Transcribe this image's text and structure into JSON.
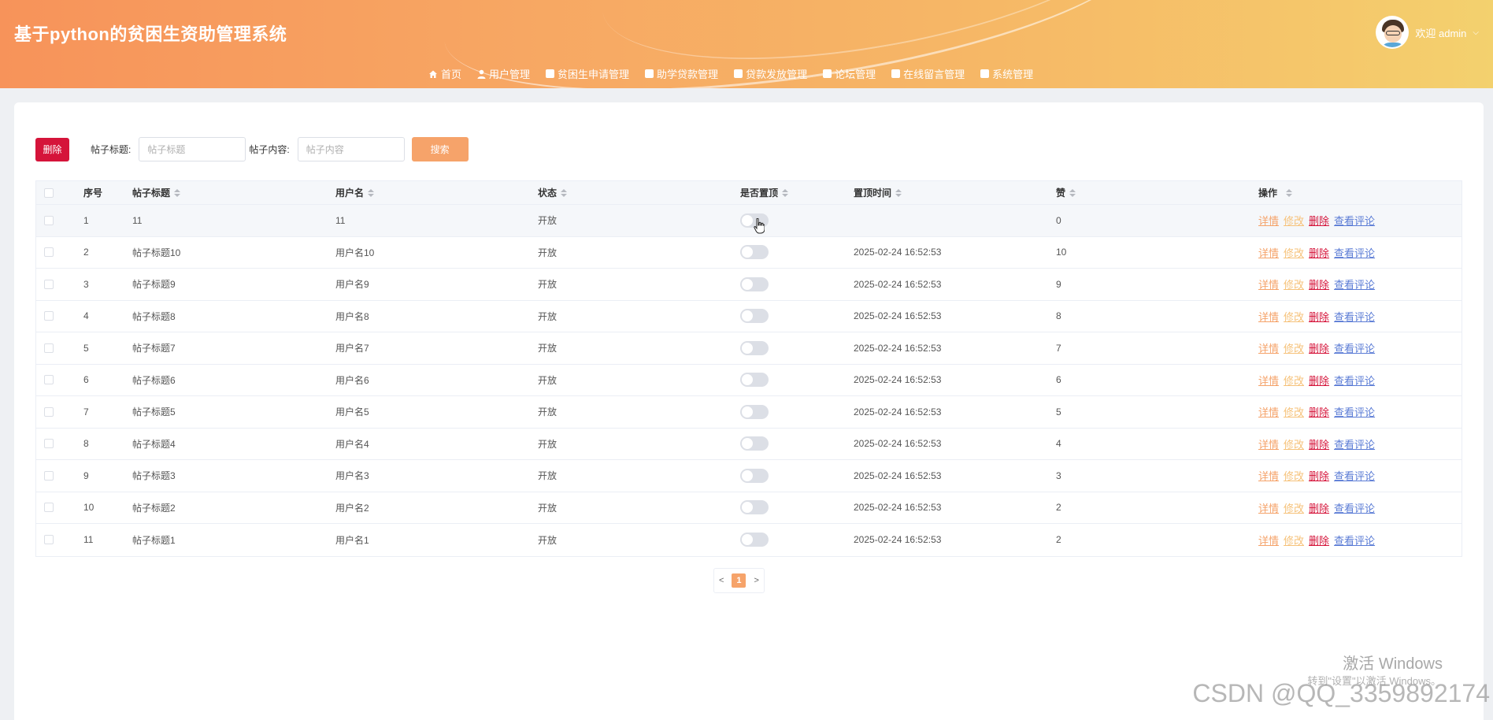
{
  "header": {
    "title": "基于python的贫困生资助管理系统",
    "welcome": "欢迎 admin",
    "nav": [
      {
        "label": "首页",
        "icon": "home-icon"
      },
      {
        "label": "用户管理",
        "icon": "user-icon"
      },
      {
        "label": "贫困生申请管理",
        "icon": "folder-icon"
      },
      {
        "label": "助学贷款管理",
        "icon": "document-icon"
      },
      {
        "label": "贷款发放管理",
        "icon": "document-icon"
      },
      {
        "label": "论坛管理",
        "icon": "document-icon"
      },
      {
        "label": "在线留言管理",
        "icon": "document-icon"
      },
      {
        "label": "系统管理",
        "icon": "settings-icon"
      }
    ]
  },
  "toolbar": {
    "delete_label": "删除",
    "title_label": "帖子标题:",
    "title_placeholder": "帖子标题",
    "content_label": "帖子内容:",
    "content_placeholder": "帖子内容",
    "search_label": "搜索"
  },
  "table": {
    "columns": [
      "序号",
      "帖子标题",
      "用户名",
      "状态",
      "是否置顶",
      "置顶时间",
      "赞",
      "操作"
    ],
    "rows": [
      {
        "idx": "1",
        "title": "11",
        "user": "11",
        "status": "开放",
        "top": false,
        "time": "",
        "likes": "0"
      },
      {
        "idx": "2",
        "title": "帖子标题10",
        "user": "用户名10",
        "status": "开放",
        "top": false,
        "time": "2025-02-24 16:52:53",
        "likes": "10"
      },
      {
        "idx": "3",
        "title": "帖子标题9",
        "user": "用户名9",
        "status": "开放",
        "top": false,
        "time": "2025-02-24 16:52:53",
        "likes": "9"
      },
      {
        "idx": "4",
        "title": "帖子标题8",
        "user": "用户名8",
        "status": "开放",
        "top": false,
        "time": "2025-02-24 16:52:53",
        "likes": "8"
      },
      {
        "idx": "5",
        "title": "帖子标题7",
        "user": "用户名7",
        "status": "开放",
        "top": false,
        "time": "2025-02-24 16:52:53",
        "likes": "7"
      },
      {
        "idx": "6",
        "title": "帖子标题6",
        "user": "用户名6",
        "status": "开放",
        "top": false,
        "time": "2025-02-24 16:52:53",
        "likes": "6"
      },
      {
        "idx": "7",
        "title": "帖子标题5",
        "user": "用户名5",
        "status": "开放",
        "top": false,
        "time": "2025-02-24 16:52:53",
        "likes": "5"
      },
      {
        "idx": "8",
        "title": "帖子标题4",
        "user": "用户名4",
        "status": "开放",
        "top": false,
        "time": "2025-02-24 16:52:53",
        "likes": "4"
      },
      {
        "idx": "9",
        "title": "帖子标题3",
        "user": "用户名3",
        "status": "开放",
        "top": false,
        "time": "2025-02-24 16:52:53",
        "likes": "3"
      },
      {
        "idx": "10",
        "title": "帖子标题2",
        "user": "用户名2",
        "status": "开放",
        "top": false,
        "time": "2025-02-24 16:52:53",
        "likes": "2"
      },
      {
        "idx": "11",
        "title": "帖子标题1",
        "user": "用户名1",
        "status": "开放",
        "top": false,
        "time": "2025-02-24 16:52:53",
        "likes": "2"
      }
    ],
    "ops": [
      "详情",
      "修改",
      "删除",
      "查看评论"
    ]
  },
  "pagination": {
    "prev": "<",
    "current": "1",
    "next": ">"
  },
  "watermark": {
    "activate_title": "激活 Windows",
    "activate_sub": "转到\"设置\"以激活 Windows。",
    "csdn": "CSDN @QQ_3359892174"
  },
  "colors": {
    "header_start": "#f7935a",
    "header_end": "#f3d16e",
    "danger": "#d5143a",
    "accent": "#f6a36a",
    "link": "#5a7bd5"
  }
}
